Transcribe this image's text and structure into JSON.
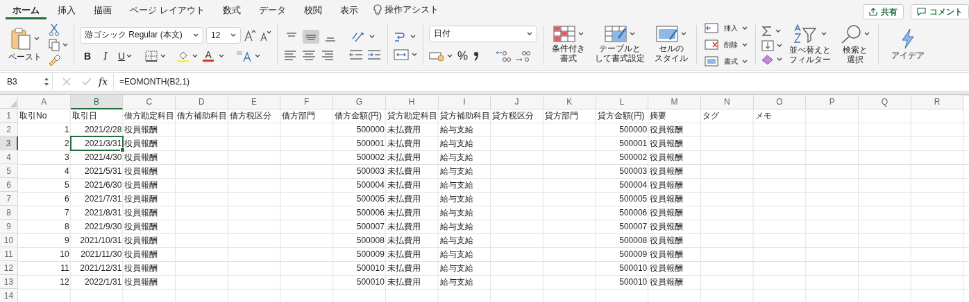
{
  "tabs": [
    {
      "label": "ホーム",
      "selected": true
    },
    {
      "label": "挿入",
      "selected": false
    },
    {
      "label": "描画",
      "selected": false
    },
    {
      "label": "ページ レイアウト",
      "selected": false
    },
    {
      "label": "数式",
      "selected": false
    },
    {
      "label": "データ",
      "selected": false
    },
    {
      "label": "校閲",
      "selected": false
    },
    {
      "label": "表示",
      "selected": false
    }
  ],
  "assist": {
    "label": "操作アシスト"
  },
  "share_button": {
    "label": "共有"
  },
  "comment_button": {
    "label": "コメント"
  },
  "ribbon": {
    "paste_label": "ペースト",
    "font_name": "游ゴシック Regular (本文)",
    "font_size": "12",
    "bold": "B",
    "italic": "I",
    "underline": "U",
    "font_color_letter": "A",
    "vertical_align": [
      {
        "selected": false
      },
      {
        "selected": true
      },
      {
        "selected": false
      }
    ],
    "number_format": "日付",
    "percent": "%",
    "style_buttons": [
      {
        "kind": "conditional",
        "label_lines": [
          "条件付き",
          "書式"
        ]
      },
      {
        "kind": "table",
        "label_lines": [
          "テーブルと",
          "して書式設定"
        ]
      },
      {
        "kind": "cell",
        "label_lines": [
          "セルの",
          "スタイル"
        ]
      }
    ],
    "cell_buttons": [
      {
        "kind": "insert",
        "label": "挿入"
      },
      {
        "kind": "delete",
        "label": "削除"
      },
      {
        "kind": "format",
        "label": "書式"
      }
    ],
    "sort_filter": [
      "並べ替えと",
      "フィルター"
    ],
    "find_select": [
      "検索と",
      "選択"
    ],
    "ideas": "アイデア"
  },
  "formula_bar": {
    "name_box": "B3",
    "function_label": "fx",
    "formula": "=EOMONTH(B2,1)"
  },
  "grid": {
    "columns": [
      {
        "label": "A",
        "selected": false
      },
      {
        "label": "B",
        "selected": true
      },
      {
        "label": "C",
        "selected": false
      },
      {
        "label": "D",
        "selected": false
      },
      {
        "label": "E",
        "selected": false
      },
      {
        "label": "F",
        "selected": false
      },
      {
        "label": "G",
        "selected": false
      },
      {
        "label": "H",
        "selected": false
      },
      {
        "label": "I",
        "selected": false
      },
      {
        "label": "J",
        "selected": false
      },
      {
        "label": "K",
        "selected": false
      },
      {
        "label": "L",
        "selected": false
      },
      {
        "label": "M",
        "selected": false
      },
      {
        "label": "N",
        "selected": false
      },
      {
        "label": "O",
        "selected": false
      },
      {
        "label": "P",
        "selected": false
      },
      {
        "label": "Q",
        "selected": false
      },
      {
        "label": "R",
        "selected": false
      }
    ],
    "rows": [
      {
        "number": "1",
        "selected": false,
        "cells": {
          "A": {
            "value": "取引No",
            "kind": "text"
          },
          "B": {
            "value": "取引日",
            "kind": "text"
          },
          "C": {
            "value": "借方勘定科目",
            "kind": "text"
          },
          "D": {
            "value": "借方補助科目",
            "kind": "text"
          },
          "E": {
            "value": "借方税区分",
            "kind": "text"
          },
          "F": {
            "value": "借方部門",
            "kind": "text"
          },
          "G": {
            "value": "借方金額(円)",
            "kind": "text"
          },
          "H": {
            "value": "貸方勘定科目",
            "kind": "text"
          },
          "I": {
            "value": "貸方補助科目",
            "kind": "text"
          },
          "J": {
            "value": "貸方税区分",
            "kind": "text"
          },
          "K": {
            "value": "貸方部門",
            "kind": "text"
          },
          "L": {
            "value": "貸方金額(円)",
            "kind": "text"
          },
          "M": {
            "value": "摘要",
            "kind": "text"
          },
          "N": {
            "value": "タグ",
            "kind": "text"
          },
          "O": {
            "value": "メモ",
            "kind": "text"
          }
        }
      },
      {
        "number": "2",
        "selected": false,
        "cells": {
          "A": {
            "value": "1",
            "kind": "number"
          },
          "B": {
            "value": "2021/2/28",
            "kind": "number"
          },
          "C": {
            "value": "役員報酬",
            "kind": "text"
          },
          "G": {
            "value": "500000",
            "kind": "number"
          },
          "H": {
            "value": "未払費用",
            "kind": "text"
          },
          "I": {
            "value": "給与支給",
            "kind": "text"
          },
          "L": {
            "value": "500000",
            "kind": "number"
          },
          "M": {
            "value": "役員報酬",
            "kind": "text"
          }
        }
      },
      {
        "number": "3",
        "selected": true,
        "cells": {
          "A": {
            "value": "2",
            "kind": "number"
          },
          "B": {
            "value": "2021/3/31",
            "kind": "number"
          },
          "C": {
            "value": "役員報酬",
            "kind": "text"
          },
          "G": {
            "value": "500001",
            "kind": "number"
          },
          "H": {
            "value": "未払費用",
            "kind": "text"
          },
          "I": {
            "value": "給与支給",
            "kind": "text"
          },
          "L": {
            "value": "500001",
            "kind": "number"
          },
          "M": {
            "value": "役員報酬",
            "kind": "text"
          }
        }
      },
      {
        "number": "4",
        "selected": false,
        "cells": {
          "A": {
            "value": "3",
            "kind": "number"
          },
          "B": {
            "value": "2021/4/30",
            "kind": "number"
          },
          "C": {
            "value": "役員報酬",
            "kind": "text"
          },
          "G": {
            "value": "500002",
            "kind": "number"
          },
          "H": {
            "value": "未払費用",
            "kind": "text"
          },
          "I": {
            "value": "給与支給",
            "kind": "text"
          },
          "L": {
            "value": "500002",
            "kind": "number"
          },
          "M": {
            "value": "役員報酬",
            "kind": "text"
          }
        }
      },
      {
        "number": "5",
        "selected": false,
        "cells": {
          "A": {
            "value": "4",
            "kind": "number"
          },
          "B": {
            "value": "2021/5/31",
            "kind": "number"
          },
          "C": {
            "value": "役員報酬",
            "kind": "text"
          },
          "G": {
            "value": "500003",
            "kind": "number"
          },
          "H": {
            "value": "未払費用",
            "kind": "text"
          },
          "I": {
            "value": "給与支給",
            "kind": "text"
          },
          "L": {
            "value": "500003",
            "kind": "number"
          },
          "M": {
            "value": "役員報酬",
            "kind": "text"
          }
        }
      },
      {
        "number": "6",
        "selected": false,
        "cells": {
          "A": {
            "value": "5",
            "kind": "number"
          },
          "B": {
            "value": "2021/6/30",
            "kind": "number"
          },
          "C": {
            "value": "役員報酬",
            "kind": "text"
          },
          "G": {
            "value": "500004",
            "kind": "number"
          },
          "H": {
            "value": "未払費用",
            "kind": "text"
          },
          "I": {
            "value": "給与支給",
            "kind": "text"
          },
          "L": {
            "value": "500004",
            "kind": "number"
          },
          "M": {
            "value": "役員報酬",
            "kind": "text"
          }
        }
      },
      {
        "number": "7",
        "selected": false,
        "cells": {
          "A": {
            "value": "6",
            "kind": "number"
          },
          "B": {
            "value": "2021/7/31",
            "kind": "number"
          },
          "C": {
            "value": "役員報酬",
            "kind": "text"
          },
          "G": {
            "value": "500005",
            "kind": "number"
          },
          "H": {
            "value": "未払費用",
            "kind": "text"
          },
          "I": {
            "value": "給与支給",
            "kind": "text"
          },
          "L": {
            "value": "500005",
            "kind": "number"
          },
          "M": {
            "value": "役員報酬",
            "kind": "text"
          }
        }
      },
      {
        "number": "8",
        "selected": false,
        "cells": {
          "A": {
            "value": "7",
            "kind": "number"
          },
          "B": {
            "value": "2021/8/31",
            "kind": "number"
          },
          "C": {
            "value": "役員報酬",
            "kind": "text"
          },
          "G": {
            "value": "500006",
            "kind": "number"
          },
          "H": {
            "value": "未払費用",
            "kind": "text"
          },
          "I": {
            "value": "給与支給",
            "kind": "text"
          },
          "L": {
            "value": "500006",
            "kind": "number"
          },
          "M": {
            "value": "役員報酬",
            "kind": "text"
          }
        }
      },
      {
        "number": "9",
        "selected": false,
        "cells": {
          "A": {
            "value": "8",
            "kind": "number"
          },
          "B": {
            "value": "2021/9/30",
            "kind": "number"
          },
          "C": {
            "value": "役員報酬",
            "kind": "text"
          },
          "G": {
            "value": "500007",
            "kind": "number"
          },
          "H": {
            "value": "未払費用",
            "kind": "text"
          },
          "I": {
            "value": "給与支給",
            "kind": "text"
          },
          "L": {
            "value": "500007",
            "kind": "number"
          },
          "M": {
            "value": "役員報酬",
            "kind": "text"
          }
        }
      },
      {
        "number": "10",
        "selected": false,
        "cells": {
          "A": {
            "value": "9",
            "kind": "number"
          },
          "B": {
            "value": "2021/10/31",
            "kind": "number"
          },
          "C": {
            "value": "役員報酬",
            "kind": "text"
          },
          "G": {
            "value": "500008",
            "kind": "number"
          },
          "H": {
            "value": "未払費用",
            "kind": "text"
          },
          "I": {
            "value": "給与支給",
            "kind": "text"
          },
          "L": {
            "value": "500008",
            "kind": "number"
          },
          "M": {
            "value": "役員報酬",
            "kind": "text"
          }
        }
      },
      {
        "number": "11",
        "selected": false,
        "cells": {
          "A": {
            "value": "10",
            "kind": "number"
          },
          "B": {
            "value": "2021/11/30",
            "kind": "number"
          },
          "C": {
            "value": "役員報酬",
            "kind": "text"
          },
          "G": {
            "value": "500009",
            "kind": "number"
          },
          "H": {
            "value": "未払費用",
            "kind": "text"
          },
          "I": {
            "value": "給与支給",
            "kind": "text"
          },
          "L": {
            "value": "500009",
            "kind": "number"
          },
          "M": {
            "value": "役員報酬",
            "kind": "text"
          }
        }
      },
      {
        "number": "12",
        "selected": false,
        "cells": {
          "A": {
            "value": "11",
            "kind": "number"
          },
          "B": {
            "value": "2021/12/31",
            "kind": "number"
          },
          "C": {
            "value": "役員報酬",
            "kind": "text"
          },
          "G": {
            "value": "500010",
            "kind": "number"
          },
          "H": {
            "value": "未払費用",
            "kind": "text"
          },
          "I": {
            "value": "給与支給",
            "kind": "text"
          },
          "L": {
            "value": "500010",
            "kind": "number"
          },
          "M": {
            "value": "役員報酬",
            "kind": "text"
          }
        }
      },
      {
        "number": "13",
        "selected": false,
        "cells": {
          "A": {
            "value": "12",
            "kind": "number"
          },
          "B": {
            "value": "2022/1/31",
            "kind": "number"
          },
          "C": {
            "value": "役員報酬",
            "kind": "text"
          },
          "G": {
            "value": "500010",
            "kind": "number"
          },
          "H": {
            "value": "未払費用",
            "kind": "text"
          },
          "I": {
            "value": "給与支給",
            "kind": "text"
          },
          "L": {
            "value": "500010",
            "kind": "number"
          },
          "M": {
            "value": "役員報酬",
            "kind": "text"
          }
        }
      },
      {
        "number": "14",
        "selected": false
      }
    ]
  }
}
